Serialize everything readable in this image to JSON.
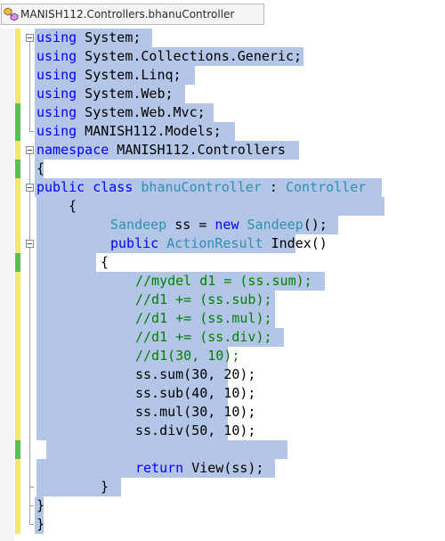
{
  "nav": {
    "class_selector": "MANISH112.Controllers.bhanuController",
    "class_icon": "class-icon"
  },
  "colors": {
    "keyword": "#0000ff",
    "type": "#2b91af",
    "comment": "#008000",
    "text": "#000000",
    "selection": "#b4c6e8",
    "change_saved": "#59c057",
    "change_unsaved": "#f3e867"
  },
  "lines": [
    {
      "tokens": [
        {
          "t": "using",
          "c": "kw"
        },
        {
          "t": " System;"
        }
      ],
      "change": "unsaved"
    },
    {
      "tokens": [
        {
          "t": "using",
          "c": "kw"
        },
        {
          "t": " System.Collections.Generic;"
        }
      ],
      "change": "unsaved"
    },
    {
      "tokens": [
        {
          "t": "using",
          "c": "kw"
        },
        {
          "t": " System.Linq;"
        }
      ],
      "change": "unsaved"
    },
    {
      "tokens": [
        {
          "t": "using",
          "c": "kw"
        },
        {
          "t": " System.Web;"
        }
      ],
      "change": "unsaved"
    },
    {
      "tokens": [
        {
          "t": "using",
          "c": "kw"
        },
        {
          "t": " System.Web.Mvc;"
        }
      ],
      "change": "saved"
    },
    {
      "tokens": [
        {
          "t": "using",
          "c": "kw"
        },
        {
          "t": " MANISH112.Models;"
        }
      ],
      "change": "saved"
    },
    {
      "tokens": [
        {
          "t": "namespace",
          "c": "kw"
        },
        {
          "t": " MANISH112.Controllers"
        }
      ],
      "change": "unsaved"
    },
    {
      "tokens": [
        {
          "t": "{"
        }
      ],
      "change": "saved"
    },
    {
      "tokens": [
        {
          "t": "public",
          "c": "kw"
        },
        {
          "t": " "
        },
        {
          "t": "class",
          "c": "kw"
        },
        {
          "t": " "
        },
        {
          "t": "bhanuController",
          "c": "ty"
        },
        {
          "t": " : "
        },
        {
          "t": "Controller",
          "c": "ty"
        }
      ],
      "change": "unsaved"
    },
    {
      "tokens": [
        {
          "t": "{"
        }
      ],
      "change": "unsaved"
    },
    {
      "tokens": [
        {
          "t": "Sandeep",
          "c": "ty"
        },
        {
          "t": " ss = "
        },
        {
          "t": "new",
          "c": "kw"
        },
        {
          "t": " "
        },
        {
          "t": "Sandeep",
          "c": "ty"
        },
        {
          "t": "();"
        }
      ],
      "change": "unsaved"
    },
    {
      "tokens": [
        {
          "t": "public",
          "c": "kw"
        },
        {
          "t": " "
        },
        {
          "t": "ActionResult",
          "c": "ty"
        },
        {
          "t": " Index()"
        }
      ],
      "change": "unsaved"
    },
    {
      "tokens": [
        {
          "t": "{"
        }
      ],
      "change": "saved"
    },
    {
      "tokens": [
        {
          "t": "//mydel d1 = (ss.sum);",
          "c": "cm"
        }
      ],
      "change": "unsaved"
    },
    {
      "tokens": [
        {
          "t": "//d1 += (ss.sub);",
          "c": "cm"
        }
      ],
      "change": "unsaved"
    },
    {
      "tokens": [
        {
          "t": "//d1 += (ss.mul);",
          "c": "cm"
        }
      ],
      "change": "unsaved"
    },
    {
      "tokens": [
        {
          "t": "//d1 += (ss.div);",
          "c": "cm"
        }
      ],
      "change": "unsaved"
    },
    {
      "tokens": [
        {
          "t": "//d1(30, 10);",
          "c": "cm"
        }
      ],
      "change": "unsaved"
    },
    {
      "tokens": [
        {
          "t": "ss.sum(30, 20);"
        }
      ],
      "change": "unsaved"
    },
    {
      "tokens": [
        {
          "t": "ss.sub(40, 10);"
        }
      ],
      "change": "unsaved"
    },
    {
      "tokens": [
        {
          "t": "ss.mul(30, 10);"
        }
      ],
      "change": "unsaved"
    },
    {
      "tokens": [
        {
          "t": "ss.div(50, 10);"
        }
      ],
      "change": "unsaved"
    },
    {
      "tokens": [],
      "change": "saved"
    },
    {
      "tokens": [
        {
          "t": "return",
          "c": "kw"
        },
        {
          "t": " View(ss);"
        }
      ],
      "change": "unsaved"
    },
    {
      "tokens": [
        {
          "t": "}"
        }
      ],
      "change": "unsaved"
    },
    {
      "tokens": [
        {
          "t": "}"
        }
      ],
      "change": "unsaved"
    },
    {
      "tokens": [
        {
          "t": "}"
        }
      ],
      "change": "unsaved"
    }
  ]
}
